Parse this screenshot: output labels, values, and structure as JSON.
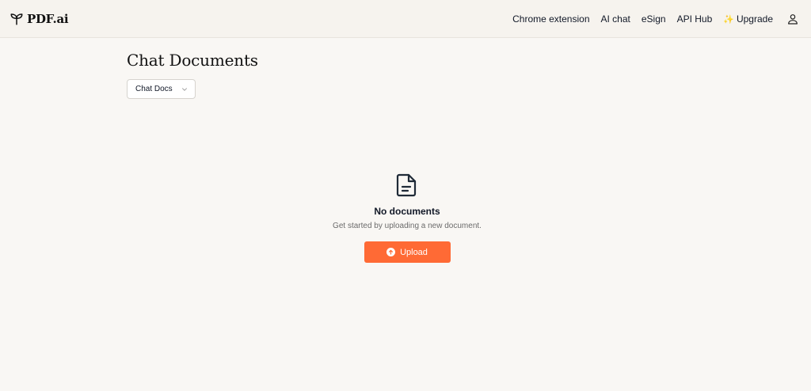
{
  "brand": {
    "name": "PDF.ai",
    "icon": "sprout-logo-icon"
  },
  "nav": {
    "links": [
      {
        "label": "Chrome extension"
      },
      {
        "label": "AI chat"
      },
      {
        "label": "eSign"
      },
      {
        "label": "API Hub"
      }
    ],
    "upgrade": {
      "label": "Upgrade",
      "icon": "sparkle-icon",
      "glyph": "✨"
    },
    "user_icon": "user-icon"
  },
  "page": {
    "title": "Chat Documents",
    "filter": {
      "selected": "Chat Docs",
      "icon": "chevron-down-icon"
    }
  },
  "empty_state": {
    "icon": "document-icon",
    "title": "No documents",
    "subtitle": "Get started by uploading a new document.",
    "button": {
      "label": "Upload",
      "icon": "arrow-up-circle-icon"
    }
  },
  "colors": {
    "background": "#f9f7f4",
    "topbar": "#f6f3ee",
    "accent": "#ff6a35",
    "sparkle": "#f5b301"
  }
}
